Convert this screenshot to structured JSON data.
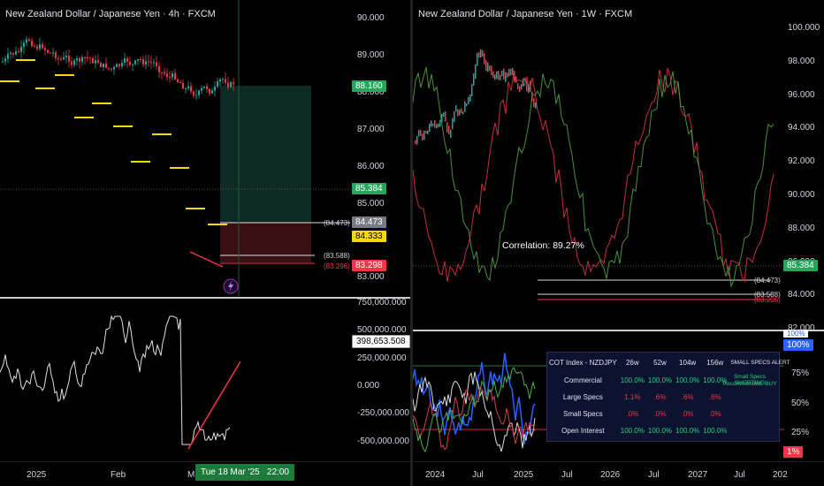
{
  "left_chart": {
    "title": "New Zealand Dollar / Japanese Yen · 4h · FXCM",
    "price_axis": [
      "90.000",
      "89.000",
      "88.000",
      "87.000",
      "86.000",
      "85.000",
      "84.000",
      "83.000"
    ],
    "tags": {
      "target": "88.160",
      "current": "85.384",
      "level1_text": "(84.473)",
      "level1": "84.473",
      "yellow": "84.333",
      "level2_text": "(83.588)",
      "level3_text": "(83.296)",
      "red": "83.298"
    },
    "indicator_axis": [
      "750,000.000",
      "500,000.000",
      "250,000.000",
      "0.000",
      "-250,000.000",
      "-500,000.000"
    ],
    "indicator_value": "398,653.508",
    "time_axis": [
      "2025",
      "Feb",
      "Mar"
    ],
    "crosshair_time": "Tue 18 Mar '25",
    "crosshair_clock": "22:00"
  },
  "right_chart": {
    "title": "New Zealand Dollar / Japanese Yen · 1W · FXCM",
    "price_axis": [
      "100.000",
      "98.000",
      "96.000",
      "94.000",
      "92.000",
      "90.000",
      "88.000",
      "86.000",
      "84.000",
      "82.000"
    ],
    "current": "85.384",
    "correlation": "Correlation: 89.27%",
    "level1_text": "(84.473)",
    "level2_text": "(83.588)",
    "level3_text": "(83.296)",
    "indicator_axis": [
      "75%",
      "50%",
      "25%"
    ],
    "tag_top": "100%",
    "tag_top2": "100%",
    "tag_bottom": "1%",
    "time_axis": [
      "2024",
      "Jul",
      "2025",
      "Jul",
      "2026",
      "Jul",
      "2027",
      "Jul",
      "202"
    ],
    "cot": {
      "header": [
        "COT Index - NZDJPY",
        "26w",
        "52w",
        "104w",
        "156w",
        "SMALL SPECS ALERT"
      ],
      "rows": [
        {
          "label": "Commercial",
          "v": [
            "100.0%",
            "100.0%",
            "100.0%",
            "100.0%"
          ]
        },
        {
          "label": "Large Specs",
          "v": [
            "1.1%",
            ".6%",
            ".6%",
            ".6%"
          ]
        },
        {
          "label": "Small Specs",
          "v": [
            ".0%",
            ".0%",
            ".0%",
            ".0%"
          ]
        },
        {
          "label": "Open Interest",
          "v": [
            "100.0%",
            "100.0%",
            "100.0%",
            "100.0%"
          ]
        }
      ],
      "alert1": "Small Specs SHORTING",
      "alert2": "Recommended: BUY"
    }
  },
  "colors": {
    "up": "#26a69a",
    "down": "#f23645",
    "green_tag": "#26a65a",
    "yellow_tag": "#f5d90a",
    "blue": "#2962ff"
  }
}
